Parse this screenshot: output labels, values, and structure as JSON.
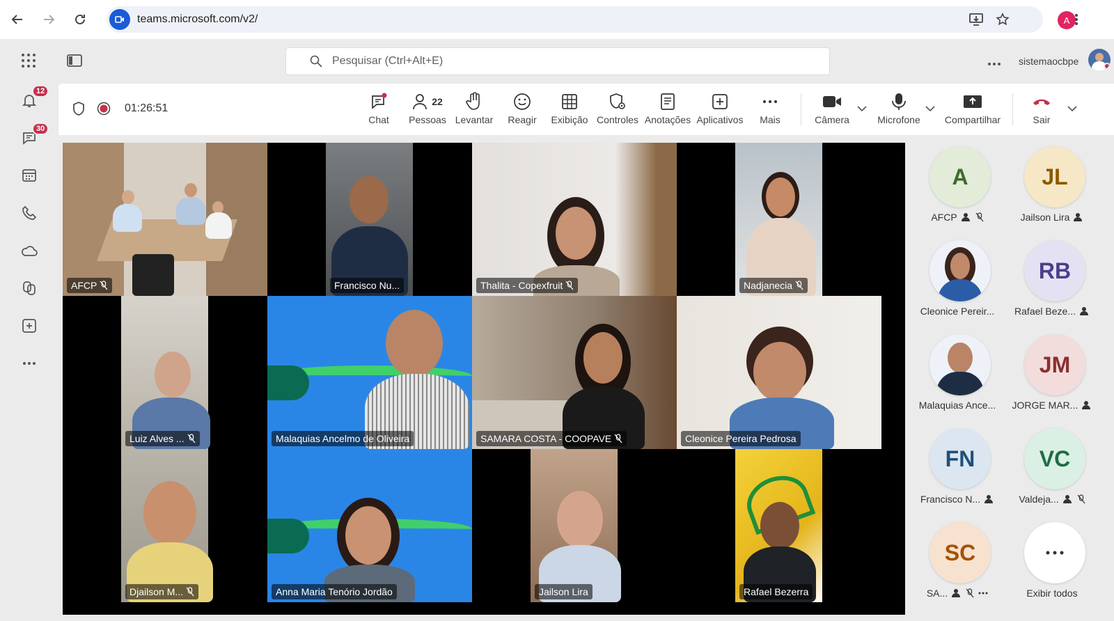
{
  "browser": {
    "url": "teams.microsoft.com/v2/",
    "profile_initial": "A"
  },
  "header": {
    "search_placeholder": "Pesquisar (Ctrl+Alt+E)",
    "username": "sistemaocbpe"
  },
  "rail": {
    "notifications_badge": "12",
    "chat_badge": "30"
  },
  "meeting": {
    "timer": "01:26:51",
    "toolbar": {
      "chat": "Chat",
      "people": "Pessoas",
      "people_count": "22",
      "raise": "Levantar",
      "react": "Reagir",
      "view": "Exibição",
      "controls": "Controles",
      "notes": "Anotações",
      "apps": "Aplicativos",
      "more": "Mais",
      "camera": "Câmera",
      "mic": "Microfone",
      "share": "Compartilhar",
      "leave": "Sair"
    }
  },
  "tiles": [
    {
      "name": "AFCP",
      "muted": true
    },
    {
      "name": "Francisco Nu...",
      "muted": false
    },
    {
      "name": "Thalita - Copexfruit",
      "muted": true
    },
    {
      "name": "Nadjanecia",
      "muted": true
    },
    {
      "name": "Luiz Alves ...",
      "muted": true
    },
    {
      "name": "Malaquias Ancelmo de Oliveira",
      "muted": false
    },
    {
      "name": "SAMARA COSTA - COOPAVE",
      "muted": true
    },
    {
      "name": "Cleonice Pereira Pedrosa",
      "muted": false
    },
    {
      "name": "Djailson M...",
      "muted": true
    },
    {
      "name": "Anna Maria Tenório Jordão",
      "muted": false
    },
    {
      "name": "Jailson Lira",
      "muted": false
    },
    {
      "name": "Rafael Bezerra",
      "muted": false
    }
  ],
  "roster": [
    {
      "initials": "A",
      "name": "AFCP",
      "bg": "#e2ecd9",
      "fg": "#3f6b2a"
    },
    {
      "initials": "JL",
      "name": "Jailson Lira",
      "bg": "#f6e7c7",
      "fg": "#8a5a00"
    },
    {
      "initials": "",
      "name": "Cleonice Pereir...",
      "bg": "#3b5a8c",
      "fg": "#fff"
    },
    {
      "initials": "RB",
      "name": "Rafael Beze...",
      "bg": "#e4e2f2",
      "fg": "#4a3f8c"
    },
    {
      "initials": "",
      "name": "Malaquias Ance...",
      "bg": "#2d4d7a",
      "fg": "#fff"
    },
    {
      "initials": "JM",
      "name": "JORGE MAR...",
      "bg": "#f3dcdc",
      "fg": "#8a2f2f"
    },
    {
      "initials": "FN",
      "name": "Francisco N...",
      "bg": "#dbe6f1",
      "fg": "#1f4f7a"
    },
    {
      "initials": "VC",
      "name": "Valdeja...",
      "bg": "#daf0e4",
      "fg": "#1f6b45"
    },
    {
      "initials": "SC",
      "name": "SA...",
      "bg": "#f7e2d0",
      "fg": "#a35200"
    },
    {
      "initials": "",
      "name": "Exibir todos",
      "bg": "#ffffff",
      "fg": "#333"
    }
  ]
}
